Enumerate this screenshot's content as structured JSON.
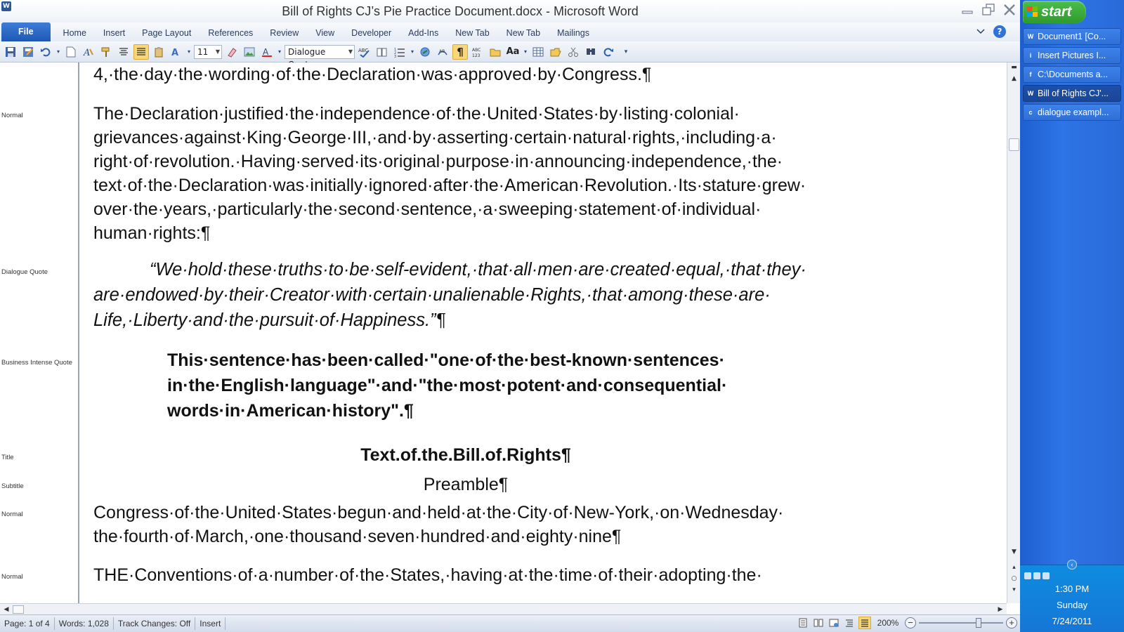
{
  "window": {
    "title": "Bill of Rights CJ’s Pie Practice Document.docx  -  Microsoft Word",
    "app_icon": "W"
  },
  "ribbon": {
    "tabs": [
      "File",
      "Home",
      "Insert",
      "Page Layout",
      "References",
      "Review",
      "View",
      "Developer",
      "Add-Ins",
      "New Tab",
      "New Tab",
      "Mailings"
    ],
    "help": "?"
  },
  "toolbar": {
    "font_size": "11",
    "style": "Dialogue Quote"
  },
  "style_area": {
    "labels": [
      "Normal",
      "Dialogue Quote",
      "Business Intense Quote",
      "Title",
      "Subtitle",
      "Normal",
      "Normal"
    ]
  },
  "document": {
    "p0": "4,·the·day·the·wording·of·the·Declaration·was·approved·by·Congress.¶",
    "p1": "The·Declaration·justified·the·independence·of·the·United·States·by·listing·colonial· grievances·against·King·George·III,·and·by·asserting·certain·natural·rights,·including·a· right·of·revolution.·Having·served·its·original·purpose·in·announcing·independence,·the· text·of·the·Declaration·was·initially·ignored·after·the·American·Revolution.·Its·stature·grew· over·the·years,·particularly·the·second·sentence,·a·sweeping·statement·of·individual· human·rights:¶",
    "quote": "“We·hold·these·truths·to·be·self-evident,·that·all·men·are·created·equal,·that·they· are·endowed·by·their·Creator·with·certain·unalienable·Rights,·that·among·these·are· Life,·Liberty·and·the·pursuit·of·Happiness.”¶",
    "intense": "This·sentence·has·been·called·\"one·of·the·best-known·sentences· in·the·English·language\"·and·\"the·most·potent·and·consequential· words·in·American·history\".¶",
    "title": "Text.of.the.Bill.of.Rights¶",
    "subtitle": "Preamble¶",
    "p2": "Congress·of·the·United·States·begun·and·held·at·the·City·of·New-York,·on·Wednesday· the·fourth·of·March,·one·thousand·seven·hundred·and·eighty·nine¶",
    "p3": "THE·Conventions·of·a·number·of·the·States,·having·at·the·time·of·their·adopting·the·"
  },
  "statusbar": {
    "page": "Page: 1 of 4",
    "words": "Words: 1,028",
    "track": "Track Changes: Off",
    "mode": "Insert",
    "zoom": "200%",
    "zoom_level_fraction": 0.72
  },
  "taskbar": {
    "start": "start",
    "items": [
      {
        "label": "Document1 [Co...",
        "icon": "W"
      },
      {
        "label": "Insert Pictures I...",
        "icon": "i"
      },
      {
        "label": "C:\\Documents a...",
        "icon": "f"
      },
      {
        "label": "Bill of Rights CJ'...",
        "icon": "W"
      },
      {
        "label": "dialogue exampl...",
        "icon": "c"
      }
    ],
    "time": "1:30 PM",
    "day": "Sunday",
    "date": "7/24/2011"
  },
  "colors": {
    "file_tab": "#1e58b4",
    "taskbar": "#2d74e6",
    "start_green": "#2f9a2f",
    "active_highlight": "#f9d776"
  }
}
